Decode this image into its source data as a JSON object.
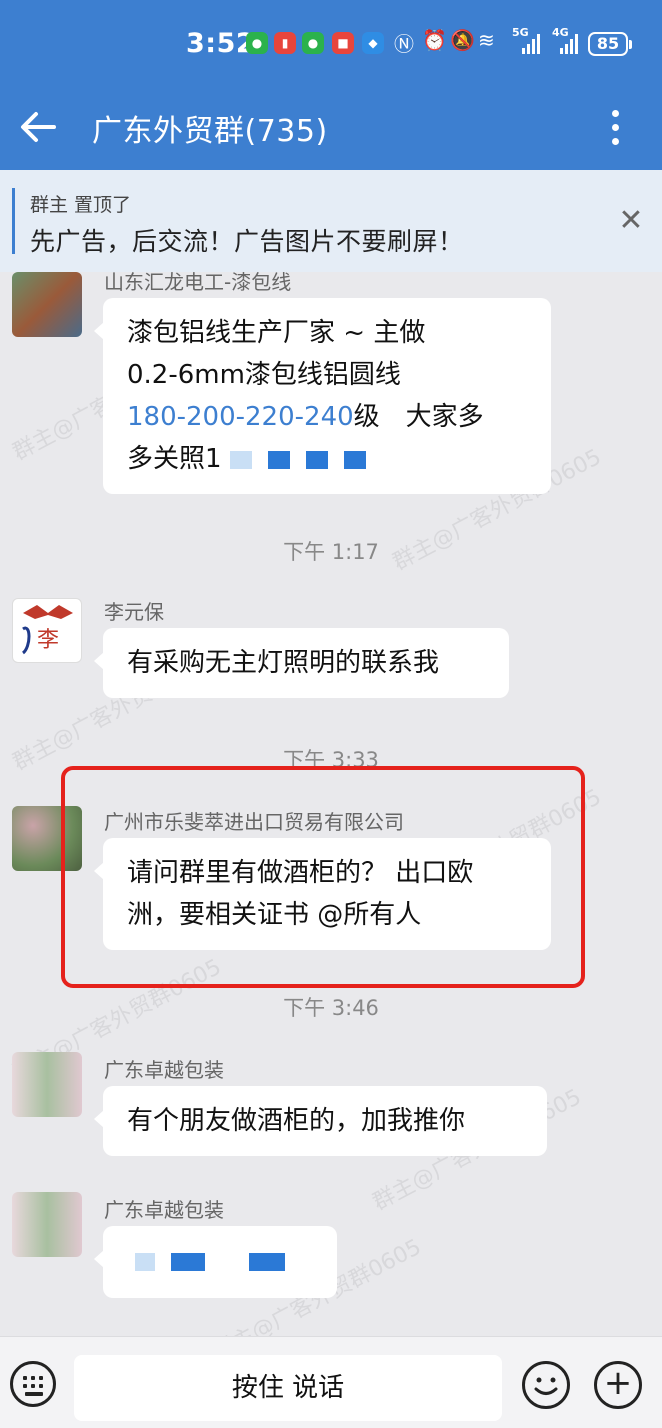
{
  "status": {
    "time": "3:52",
    "battery": "85",
    "net1": "5G",
    "net2": "4G"
  },
  "header": {
    "title": "广东外贸群(735)"
  },
  "pinned": {
    "owner_label": "群主 置顶了",
    "text": "先广告，后交流！广告图片不要刷屏！"
  },
  "messages": {
    "m1": {
      "sender": "山东汇龙电工-漆包线",
      "line1": "漆包铝线生产厂家 ~ 主做",
      "line2": "0.2-6mm漆包线铝圆线",
      "phone": "180-200-220-240",
      "line3_suffix": "级　大家多",
      "line4_prefix": "多关照1"
    },
    "t1": "下午 1:17",
    "m2": {
      "sender": "李元保",
      "text": "有采购无主灯照明的联系我"
    },
    "t2": "下午 3:33",
    "m3": {
      "sender": "广州市乐斐萃进出口贸易有限公司",
      "line1": "请问群里有做酒柜的？ 出口欧",
      "line2": "洲，要相关证书 @所有人"
    },
    "t3": "下午 3:46",
    "m4": {
      "sender": "广东卓越包装",
      "text": "有个朋友做酒柜的，加我推你"
    },
    "m5": {
      "sender": "广东卓越包装"
    }
  },
  "watermark": "群主@广客外贸群0605",
  "bottom": {
    "voice_label": "按住 说话"
  },
  "colors": {
    "header": "#3d7fd0",
    "highlight": "#e5221c",
    "link": "#3d7fd0"
  }
}
